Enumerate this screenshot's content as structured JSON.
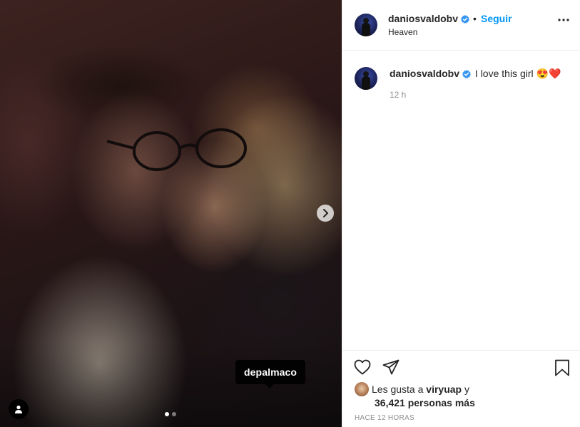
{
  "post": {
    "username": "daniosvaldobv",
    "separator": "•",
    "follow_label": "Seguir",
    "location": "Heaven",
    "caption_text": "I love this girl 😍❤️",
    "caption_time": "12 h",
    "photo_tag": "depalmaco",
    "carousel": {
      "count": 2,
      "active_index": 0
    },
    "likes": {
      "prefix": "Les gusta a",
      "liked_by": "viryuap",
      "joiner": "y",
      "others": "36,421 personas más"
    },
    "posted_ago": "HACE 12 HORAS"
  },
  "icons": {
    "verified": "verified-badge-icon",
    "more": "more-options-icon",
    "next": "chevron-right-icon",
    "user_tag": "user-tag-icon",
    "like": "heart-icon",
    "share": "paper-plane-icon",
    "save": "bookmark-icon"
  },
  "colors": {
    "link": "#0095f6",
    "verified": "#3897f0",
    "muted": "#8e8e8e",
    "text": "#262626"
  }
}
